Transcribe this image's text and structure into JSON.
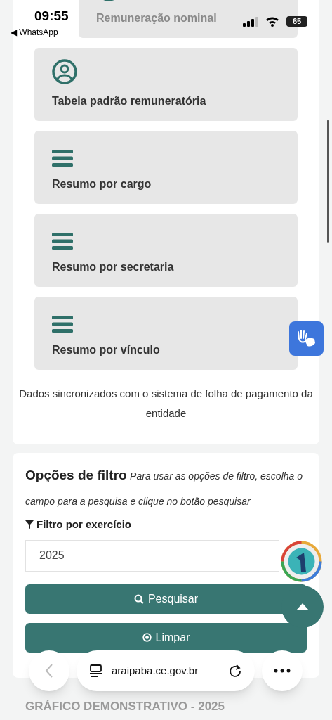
{
  "status_bar": {
    "time": "09:55",
    "back_app": "◀ WhatsApp",
    "battery": "65"
  },
  "menu_cards": [
    {
      "kind": "person",
      "label": "Remuneração nominal"
    },
    {
      "kind": "person",
      "label": "Tabela padrão remuneratória"
    },
    {
      "kind": "list",
      "label": "Resumo por cargo"
    },
    {
      "kind": "list",
      "label": "Resumo por secretaria"
    },
    {
      "kind": "list",
      "label": "Resumo por vínculo"
    }
  ],
  "sync_note": "Dados sincronizados com o sistema de folha de pagamento da entidade",
  "filter": {
    "title": "Opções de filtro",
    "hint": "Para usar as opções de filtro, escolha o campo para a pesquisa e clique no botão pesquisar",
    "field_label": "Filtro por exercício",
    "year_value": "2025",
    "buttons": [
      {
        "kind": "search",
        "label": "Pesquisar"
      },
      {
        "kind": "clear",
        "label": "Limpar"
      }
    ]
  },
  "chart_section": {
    "title": "GRÁFICO DEMONSTRATIVO - 2025"
  },
  "browser_bar": {
    "url": "araipaba.ce.gov.br"
  }
}
